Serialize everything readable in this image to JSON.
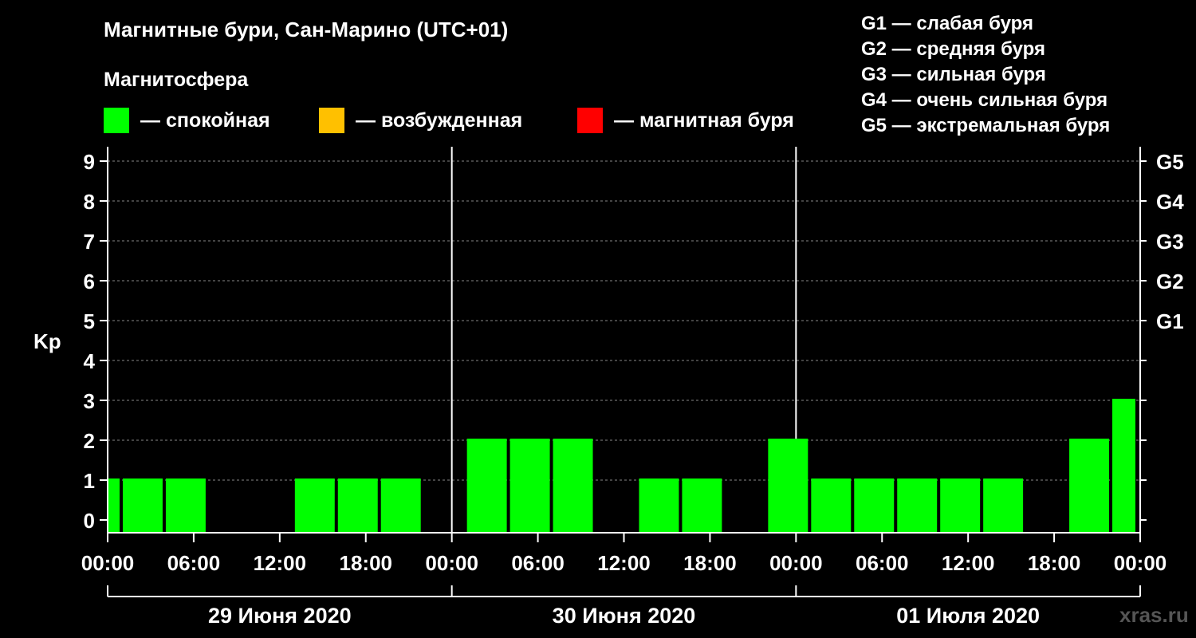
{
  "header": {
    "title": "Магнитные бури, Сан-Марино (UTC+01)",
    "subtitle": "Магнитосфера"
  },
  "legend": [
    {
      "label": "— спокойная",
      "color": "#00ff00"
    },
    {
      "label": "— возбужденная",
      "color": "#ffc000"
    },
    {
      "label": "— магнитная буря",
      "color": "#ff0000"
    }
  ],
  "storm_scale": [
    "G1 — слабая буря",
    "G2 — средняя буря",
    "G3 — сильная буря",
    "G4 — очень сильная буря",
    "G5 — экстремальная буря"
  ],
  "watermark": "xras.ru",
  "chart_data": {
    "type": "bar",
    "ylabel": "Kp",
    "ylim": [
      0,
      9
    ],
    "y_ticks": [
      "0",
      "1",
      "2",
      "3",
      "4",
      "5",
      "6",
      "7",
      "8",
      "9"
    ],
    "right_ticks": [
      {
        "value": 5,
        "label": "G1"
      },
      {
        "value": 6,
        "label": "G2"
      },
      {
        "value": 7,
        "label": "G3"
      },
      {
        "value": 8,
        "label": "G4"
      },
      {
        "value": 9,
        "label": "G5"
      }
    ],
    "x_tick_labels": [
      "00:00",
      "06:00",
      "12:00",
      "18:00",
      "00:00",
      "06:00",
      "12:00",
      "18:00",
      "00:00",
      "06:00",
      "12:00",
      "18:00",
      "00:00"
    ],
    "days": [
      "29 Июня 2020",
      "30 Июня 2020",
      "01 Июля 2020"
    ],
    "bar_color": "#00ff00",
    "series": [
      {
        "values": [
          {
            "start": "29 Июня 2020 00:00",
            "end": "29 Июня 2020 01:00",
            "kp": 1
          },
          {
            "start": "29 Июня 2020 01:00",
            "end": "29 Июня 2020 04:00",
            "kp": 1
          },
          {
            "start": "29 Июня 2020 04:00",
            "end": "29 Июня 2020 07:00",
            "kp": 1
          },
          {
            "start": "29 Июня 2020 07:00",
            "end": "29 Июня 2020 10:00",
            "kp": 0
          },
          {
            "start": "29 Июня 2020 10:00",
            "end": "29 Июня 2020 13:00",
            "kp": 0
          },
          {
            "start": "29 Июня 2020 13:00",
            "end": "29 Июня 2020 16:00",
            "kp": 1
          },
          {
            "start": "29 Июня 2020 16:00",
            "end": "29 Июня 2020 19:00",
            "kp": 1
          },
          {
            "start": "29 Июня 2020 19:00",
            "end": "29 Июня 2020 22:00",
            "kp": 1
          },
          {
            "start": "29 Июня 2020 22:00",
            "end": "30 Июня 2020 01:00",
            "kp": 0
          },
          {
            "start": "30 Июня 2020 01:00",
            "end": "30 Июня 2020 04:00",
            "kp": 2
          },
          {
            "start": "30 Июня 2020 04:00",
            "end": "30 Июня 2020 07:00",
            "kp": 2
          },
          {
            "start": "30 Июня 2020 07:00",
            "end": "30 Июня 2020 10:00",
            "kp": 2
          },
          {
            "start": "30 Июня 2020 10:00",
            "end": "30 Июня 2020 13:00",
            "kp": 0
          },
          {
            "start": "30 Июня 2020 13:00",
            "end": "30 Июня 2020 16:00",
            "kp": 1
          },
          {
            "start": "30 Июня 2020 16:00",
            "end": "30 Июня 2020 19:00",
            "kp": 1
          },
          {
            "start": "30 Июня 2020 19:00",
            "end": "30 Июня 2020 22:00",
            "kp": 0
          },
          {
            "start": "30 Июня 2020 22:00",
            "end": "01 Июля 2020 01:00",
            "kp": 2
          },
          {
            "start": "01 Июля 2020 01:00",
            "end": "01 Июля 2020 04:00",
            "kp": 1
          },
          {
            "start": "01 Июля 2020 04:00",
            "end": "01 Июля 2020 07:00",
            "kp": 1
          },
          {
            "start": "01 Июля 2020 07:00",
            "end": "01 Июля 2020 10:00",
            "kp": 1
          },
          {
            "start": "01 Июля 2020 10:00",
            "end": "01 Июля 2020 13:00",
            "kp": 1
          },
          {
            "start": "01 Июля 2020 13:00",
            "end": "01 Июля 2020 16:00",
            "kp": 1
          },
          {
            "start": "01 Июля 2020 16:00",
            "end": "01 Июля 2020 19:00",
            "kp": 0
          },
          {
            "start": "01 Июля 2020 19:00",
            "end": "01 Июля 2020 22:00",
            "kp": 2
          },
          {
            "start": "01 Июля 2020 22:00",
            "end": "02 Июля 2020 00:00",
            "kp": 3
          }
        ]
      }
    ],
    "grid": true
  }
}
